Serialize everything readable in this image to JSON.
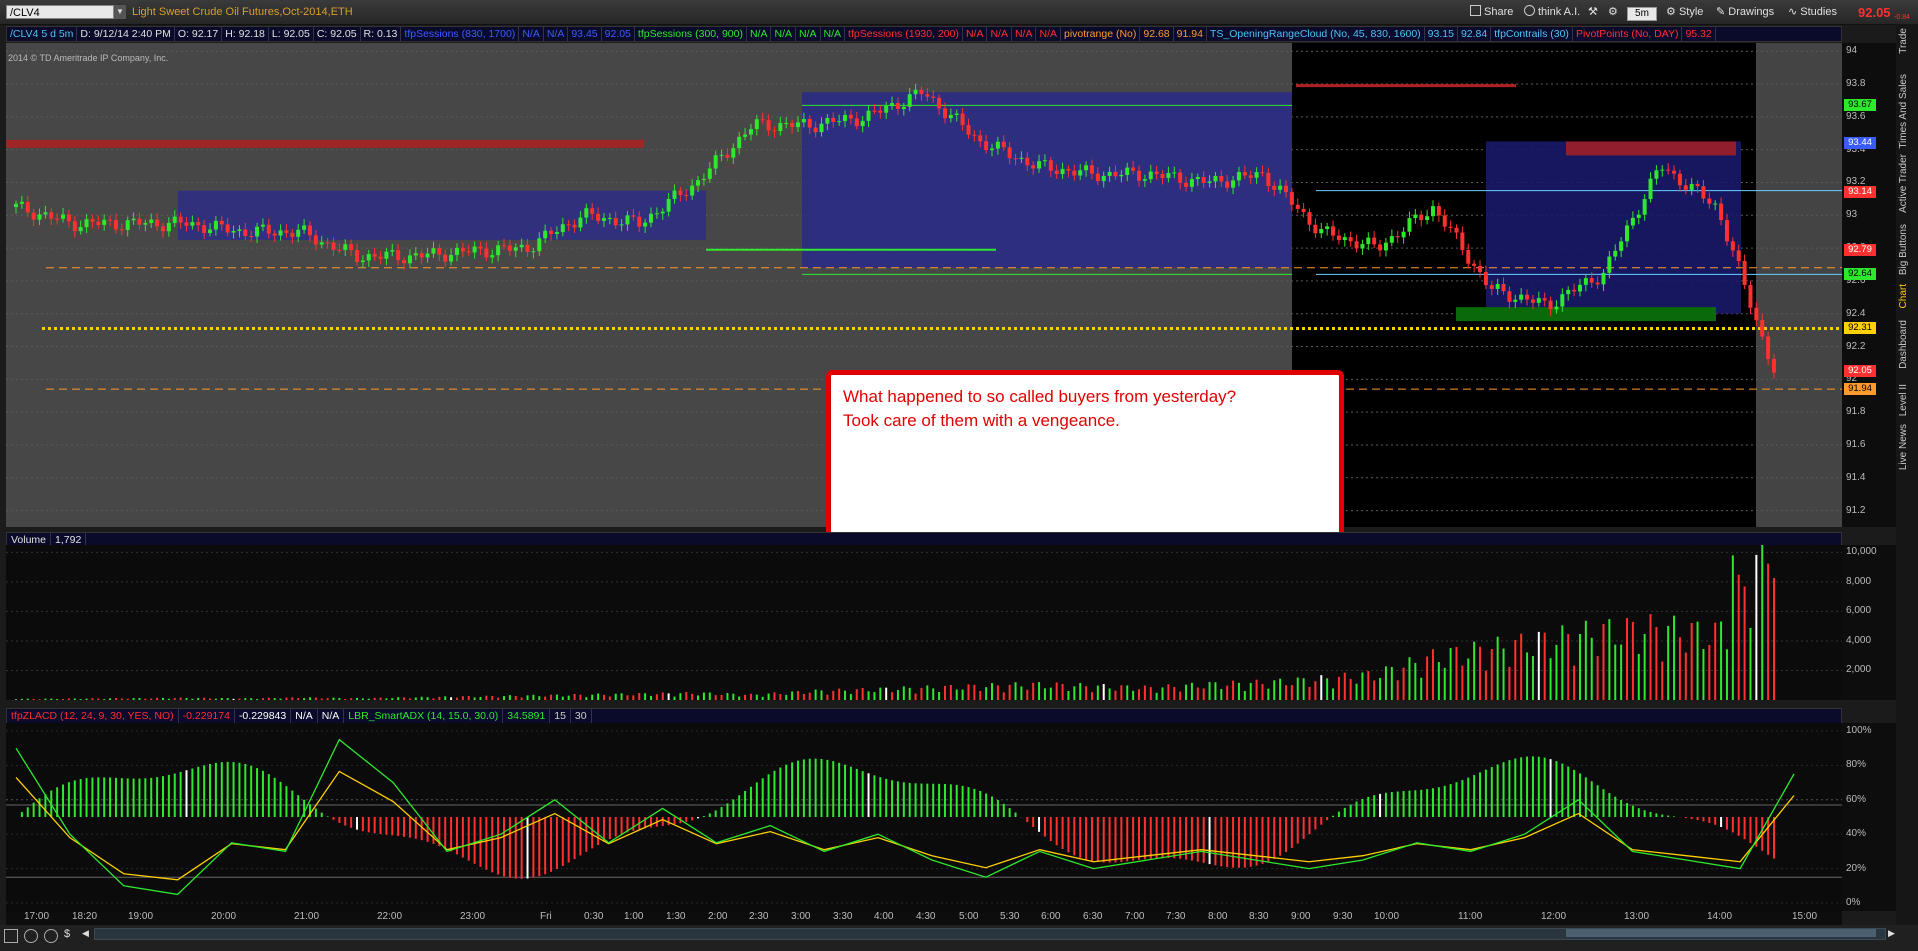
{
  "topbar": {
    "symbol": "/CLV4",
    "instrument": "Light Sweet Crude Oil Futures,Oct-2014,ETH",
    "share_label": "Share",
    "think_ai_label": "think A.I.",
    "timeframe": "5m",
    "style_label": "Style",
    "drawings_label": "Drawings",
    "studies_label": "Studies",
    "last_price": "92.05",
    "last_change": "-0.84"
  },
  "studybar": [
    {
      "text": "/CLV4 5 d 5m",
      "color": "#4fc3f7"
    },
    {
      "text": "D: 9/12/14 2:40 PM",
      "color": "#e0e0e0"
    },
    {
      "text": "O: 92.17",
      "color": "#e0e0e0"
    },
    {
      "text": "H: 92.18",
      "color": "#e0e0e0"
    },
    {
      "text": "L: 92.05",
      "color": "#e0e0e0"
    },
    {
      "text": "C: 92.05",
      "color": "#e0e0e0"
    },
    {
      "text": "R: 0.13",
      "color": "#e0e0e0"
    },
    {
      "text": "tfpSessions (830, 1700)",
      "color": "#3a5cff"
    },
    {
      "text": "N/A",
      "color": "#3a5cff"
    },
    {
      "text": "N/A",
      "color": "#3a5cff"
    },
    {
      "text": "93.45",
      "color": "#3a5cff"
    },
    {
      "text": "92.05",
      "color": "#3a5cff"
    },
    {
      "text": "tfpSessions (300, 900)",
      "color": "#2ee82e"
    },
    {
      "text": "N/A",
      "color": "#2ee82e"
    },
    {
      "text": "N/A",
      "color": "#2ee82e"
    },
    {
      "text": "N/A",
      "color": "#2ee82e"
    },
    {
      "text": "N/A",
      "color": "#2ee82e"
    },
    {
      "text": "tfpSessions (1930, 200)",
      "color": "#ff3030"
    },
    {
      "text": "N/A",
      "color": "#ff3030"
    },
    {
      "text": "N/A",
      "color": "#ff3030"
    },
    {
      "text": "N/A",
      "color": "#ff3030"
    },
    {
      "text": "N/A",
      "color": "#ff3030"
    },
    {
      "text": "pivotrange (No)",
      "color": "#ff9a2e"
    },
    {
      "text": "92.68",
      "color": "#ff9a2e"
    },
    {
      "text": "91.94",
      "color": "#ff9a2e"
    },
    {
      "text": "TS_OpeningRangeCloud (No, 45, 830, 1600)",
      "color": "#4fc3f7"
    },
    {
      "text": "93.15",
      "color": "#4fc3f7"
    },
    {
      "text": "92.84",
      "color": "#4fc3f7"
    },
    {
      "text": "tfpContrails (30)",
      "color": "#4fc3f7"
    },
    {
      "text": "PivotPoints (No, DAY)",
      "color": "#ff3030"
    },
    {
      "text": "95.32",
      "color": "#ff3030"
    }
  ],
  "copyright": "2014 © TD Ameritrade IP Company, Inc.",
  "annotation": {
    "line1": "What happened to so called buyers from yesterday?",
    "line2": "Took care of them with a vengeance."
  },
  "volume_header": {
    "label": "Volume",
    "value": "1,792"
  },
  "osc_header": [
    {
      "text": "tfpZLACD (12, 24, 9, 30, YES, NO)",
      "color": "#ff3030"
    },
    {
      "text": "-0.229174",
      "color": "#ff3030"
    },
    {
      "text": "-0.229843",
      "color": "#ffffff"
    },
    {
      "text": "N/A",
      "color": "#ffffff"
    },
    {
      "text": "N/A",
      "color": "#ffffff"
    },
    {
      "text": "LBR_SmartADX (14, 15.0, 30.0)",
      "color": "#2ee82e"
    },
    {
      "text": "34.5891",
      "color": "#2ee82e"
    },
    {
      "text": "15",
      "color": "#cfcfcf"
    },
    {
      "text": "30",
      "color": "#cfcfcf"
    }
  ],
  "price_axis": {
    "ticks": [
      "94",
      "93.8",
      "93.6",
      "93.4",
      "93.2",
      "93",
      "92.8",
      "92.6",
      "92.4",
      "92.2",
      "92",
      "91.8",
      "91.6",
      "91.4",
      "91.2"
    ],
    "min": 91.1,
    "max": 94.05,
    "tags": [
      {
        "value": 93.67,
        "label": "93.67",
        "color": "#2ee82e"
      },
      {
        "value": 93.44,
        "label": "93.44",
        "color": "#3a5cff"
      },
      {
        "value": 93.14,
        "label": "93.14",
        "color": "#ff3030"
      },
      {
        "value": 92.79,
        "label": "92.79",
        "color": "#ff3030"
      },
      {
        "value": 92.64,
        "label": "92.64",
        "color": "#2ee82e"
      },
      {
        "value": 92.31,
        "label": "92.31",
        "color": "#ffd000"
      },
      {
        "value": 92.05,
        "label": "92.05",
        "color": "#ff3030"
      },
      {
        "value": 91.94,
        "label": "91.94",
        "color": "#ff9a2e"
      }
    ]
  },
  "volume_axis": {
    "ticks": [
      "10,000",
      "8,000",
      "6,000",
      "4,000",
      "2,000"
    ],
    "max": 10500
  },
  "osc_axis": {
    "ticks": [
      "100%",
      "80%",
      "60%",
      "40%",
      "20%",
      "0%"
    ]
  },
  "time_axis": {
    "labels": [
      "17:00",
      "18:20",
      "19:00",
      "20:00",
      "21:00",
      "22:00",
      "23:00",
      "Fri",
      "0:30",
      "1:00",
      "1:30",
      "2:00",
      "2:30",
      "3:00",
      "3:30",
      "4:00",
      "4:30",
      "5:00",
      "5:30",
      "6:00",
      "6:30",
      "7:00",
      "7:30",
      "8:00",
      "8:30",
      "9:00",
      "9:30",
      "10:00",
      "11:00",
      "12:00",
      "13:00",
      "14:00",
      "15:00"
    ]
  },
  "right_tabs": [
    "Trade",
    "Times And Sales",
    "Active Trader",
    "Big Buttons",
    "Chart",
    "Dashboard",
    "Level II",
    "Live News"
  ],
  "chart_data": [
    {
      "type": "candlestick",
      "title": "/CLV4 5 d 5m",
      "ylabel": "",
      "ylim": [
        91.1,
        94.05
      ],
      "x": [
        "17:00",
        "18:20",
        "19:00",
        "20:00",
        "21:00",
        "22:00",
        "23:00",
        "Fri",
        "0:30",
        "1:00",
        "1:30",
        "2:00",
        "2:30",
        "3:00",
        "3:30",
        "4:00",
        "4:30",
        "5:00",
        "5:30",
        "6:00",
        "6:30",
        "7:00",
        "7:30",
        "8:00",
        "8:30",
        "9:00",
        "9:30",
        "10:00",
        "11:00",
        "12:00",
        "13:00",
        "14:00"
      ],
      "close": [
        93.05,
        92.95,
        92.95,
        92.95,
        92.9,
        92.9,
        92.75,
        92.75,
        92.78,
        92.8,
        93.0,
        92.95,
        93.2,
        93.55,
        93.55,
        93.6,
        93.75,
        93.45,
        93.3,
        93.25,
        93.25,
        93.2,
        93.25,
        92.9,
        92.8,
        93.05,
        92.55,
        92.45,
        92.65,
        93.3,
        93.05,
        92.05
      ],
      "levels": {
        "pivot_high": 92.68,
        "pivot_low": 91.94,
        "opening_range_high": 93.15,
        "opening_range_low": 92.84,
        "yellow_line": 92.31
      }
    },
    {
      "type": "bar",
      "title": "Volume",
      "ylim": [
        0,
        10500
      ],
      "values": [
        60,
        80,
        100,
        120,
        90,
        140,
        100,
        150,
        200,
        250,
        300,
        350,
        400,
        300,
        500,
        600,
        700,
        800,
        900,
        800,
        700,
        900,
        1000,
        1200,
        1500,
        2500,
        3000,
        3500,
        4000,
        4200,
        3800,
        9800
      ]
    },
    {
      "type": "line",
      "title": "LBR_SmartADX (14, 15.0, 30.0)",
      "ylim": [
        0,
        100
      ],
      "values": [
        90,
        40,
        10,
        5,
        35,
        30,
        95,
        70,
        30,
        40,
        60,
        35,
        55,
        35,
        45,
        30,
        40,
        25,
        15,
        30,
        20,
        25,
        30,
        25,
        20,
        25,
        35,
        30,
        40,
        60,
        30,
        25,
        20,
        75
      ]
    }
  ]
}
